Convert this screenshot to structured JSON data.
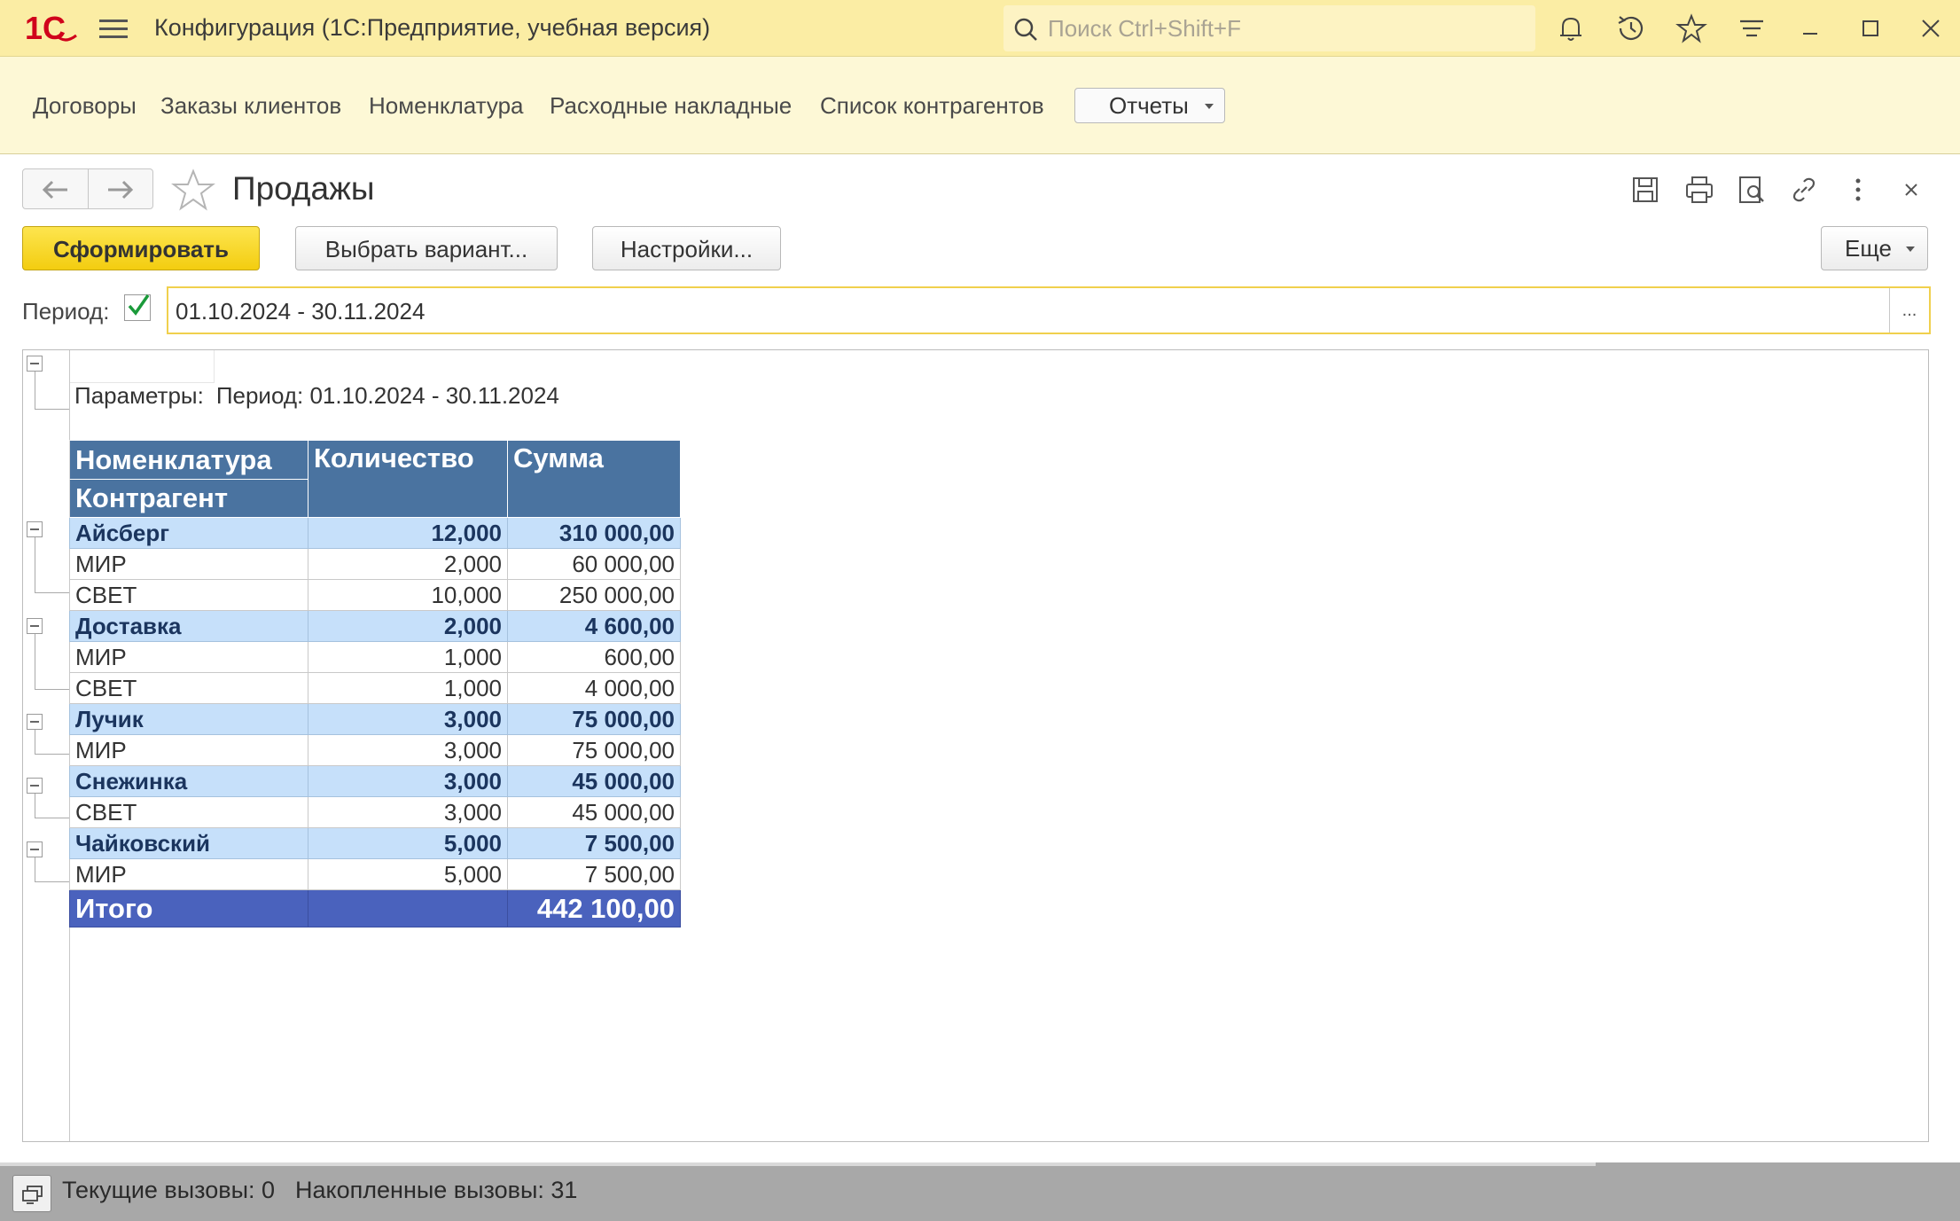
{
  "titlebar": {
    "logo_text": "1С",
    "app_title": "Конфигурация  (1С:Предприятие, учебная версия)",
    "search_placeholder": "Поиск Ctrl+Shift+F",
    "icons": [
      "bell-icon",
      "history-icon",
      "star-icon",
      "sort-icon",
      "minimize-icon",
      "maximize-icon",
      "close-icon"
    ]
  },
  "sections": {
    "links": [
      "Договоры",
      "Заказы клиентов",
      "Номенклатура",
      "Расходные накладные",
      "Список контрагентов"
    ],
    "reports_label": "Отчеты"
  },
  "form": {
    "title": "Продажы",
    "buttons": {
      "generate": "Сформировать",
      "variant": "Выбрать вариант...",
      "settings": "Настройки...",
      "more": "Еще"
    },
    "period": {
      "label": "Период:",
      "enabled": true,
      "value": "01.10.2024 - 30.11.2024",
      "select_label": "..."
    },
    "icons": [
      "save-icon",
      "print-icon",
      "preview-icon",
      "link-icon",
      "more-vertical-icon",
      "close-icon"
    ]
  },
  "report": {
    "params_label": "Параметры:",
    "params_value": "Период: 01.10.2024 - 30.11.2024",
    "headers": {
      "nomenclature": "Номенклатура",
      "counterparty": "Контрагент",
      "quantity": "Количество",
      "sum": "Сумма"
    },
    "groups": [
      {
        "name": "Айсберг",
        "qty": "12,000",
        "sum": "310 000,00",
        "items": [
          {
            "name": "МИР",
            "qty": "2,000",
            "sum": "60 000,00"
          },
          {
            "name": "СВЕТ",
            "qty": "10,000",
            "sum": "250 000,00"
          }
        ]
      },
      {
        "name": "Доставка",
        "qty": "2,000",
        "sum": "4 600,00",
        "items": [
          {
            "name": "МИР",
            "qty": "1,000",
            "sum": "600,00"
          },
          {
            "name": "СВЕТ",
            "qty": "1,000",
            "sum": "4 000,00"
          }
        ]
      },
      {
        "name": "Лучик",
        "qty": "3,000",
        "sum": "75 000,00",
        "items": [
          {
            "name": "МИР",
            "qty": "3,000",
            "sum": "75 000,00"
          }
        ]
      },
      {
        "name": "Снежинка",
        "qty": "3,000",
        "sum": "45 000,00",
        "items": [
          {
            "name": "СВЕТ",
            "qty": "3,000",
            "sum": "45 000,00"
          }
        ]
      },
      {
        "name": "Чайковский",
        "qty": "5,000",
        "sum": "7 500,00",
        "items": [
          {
            "name": "МИР",
            "qty": "5,000",
            "sum": "7 500,00"
          }
        ]
      }
    ],
    "total": {
      "label": "Итого",
      "qty": "",
      "sum": "442 100,00"
    }
  },
  "statusbar": {
    "current_calls": "Текущие вызовы: 0",
    "accumulated_calls": "Накопленные вызовы: 31"
  },
  "colors": {
    "titlebar_bg": "#fbeda4",
    "header_bg": "#4a73a0",
    "group_bg": "#c6e0fa",
    "total_bg": "#4a62bd",
    "accent_button": "#f3cd10"
  }
}
